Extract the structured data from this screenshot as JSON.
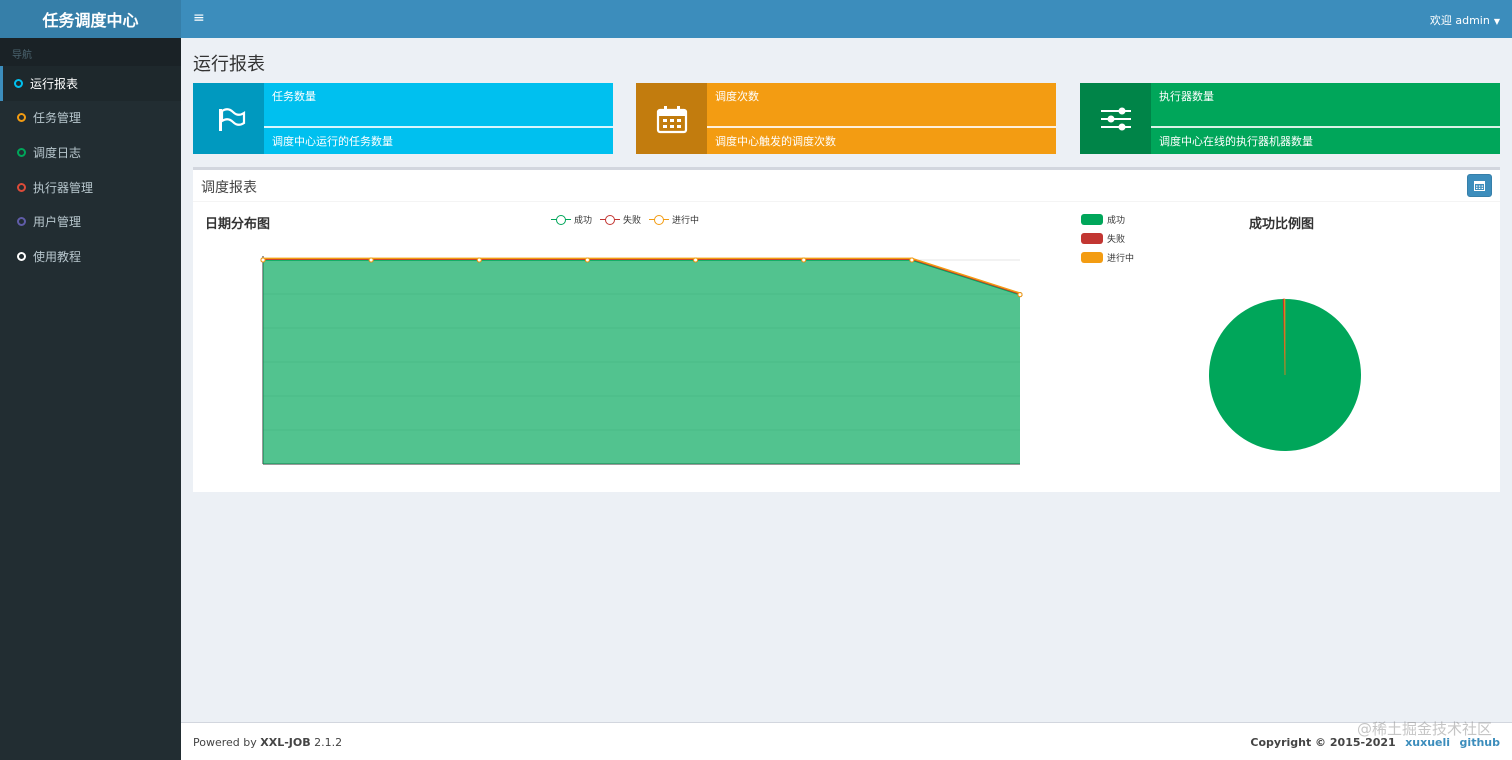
{
  "app": {
    "brand": "任务调度中心"
  },
  "header": {
    "menu_icon": "≡",
    "user_label": "欢迎 admin"
  },
  "sidebar": {
    "section_label": "导航",
    "items": [
      {
        "label": "运行报表",
        "color": "#00c0ef",
        "active": true
      },
      {
        "label": "任务管理",
        "color": "#f39c12"
      },
      {
        "label": "调度日志",
        "color": "#00a65a"
      },
      {
        "label": "执行器管理",
        "color": "#dd4b39"
      },
      {
        "label": "用户管理",
        "color": "#605ca8"
      },
      {
        "label": "使用教程",
        "color": "#ffffff"
      }
    ]
  },
  "page": {
    "title": "运行报表"
  },
  "info_boxes": [
    {
      "title": "任务数量",
      "desc": "调度中心运行的任务数量",
      "color": "#00c0ef",
      "icon": "flag-icon"
    },
    {
      "title": "调度次数",
      "desc": "调度中心触发的调度次数",
      "color": "#f39c12",
      "icon": "calendar-icon"
    },
    {
      "title": "执行器数量",
      "desc": "调度中心在线的执行器机器数量",
      "color": "#00a65a",
      "icon": "sliders-icon"
    }
  ],
  "report": {
    "box_title": "调度报表",
    "line_chart_title": "日期分布图",
    "pie_chart_title": "成功比例图",
    "line_legend": [
      {
        "name": "成功",
        "color": "#00a65a"
      },
      {
        "name": "失败",
        "color": "#c23632"
      },
      {
        "name": "进行中",
        "color": "#f39c12"
      }
    ],
    "pie_legend": [
      {
        "name": "成功",
        "color": "#00a65a"
      },
      {
        "name": "失败",
        "color": "#c23632"
      },
      {
        "name": "进行中",
        "color": "#f39c12"
      }
    ]
  },
  "chart_data": [
    {
      "type": "area",
      "title": "日期分布图",
      "categories": [
        "",
        "",
        "",
        "",
        "",
        "",
        "",
        ""
      ],
      "series": [
        {
          "name": "成功",
          "values": [
            1,
            1,
            1,
            1,
            1,
            1,
            1,
            0.83
          ]
        },
        {
          "name": "失败",
          "values": [
            0,
            0,
            0,
            0,
            0,
            0,
            0,
            0
          ]
        },
        {
          "name": "进行中",
          "values": [
            0,
            0,
            0,
            0,
            0,
            0,
            0,
            0
          ]
        }
      ],
      "ylim": [
        0,
        1
      ],
      "grid": true,
      "legend_position": "top-center"
    },
    {
      "type": "pie",
      "title": "成功比例图",
      "slices": [
        {
          "name": "成功",
          "value": 99.6
        },
        {
          "name": "失败",
          "value": 0.3
        },
        {
          "name": "进行中",
          "value": 0.1
        }
      ],
      "legend_position": "top-left"
    }
  ],
  "footer": {
    "powered_prefix": "Powered by ",
    "product": "XXL-JOB",
    "version": " 2.1.2",
    "copyright": "Copyright © 2015-2021",
    "link1": "xuxueli",
    "link2": "github"
  },
  "watermark": "@稀土掘金技术社区"
}
